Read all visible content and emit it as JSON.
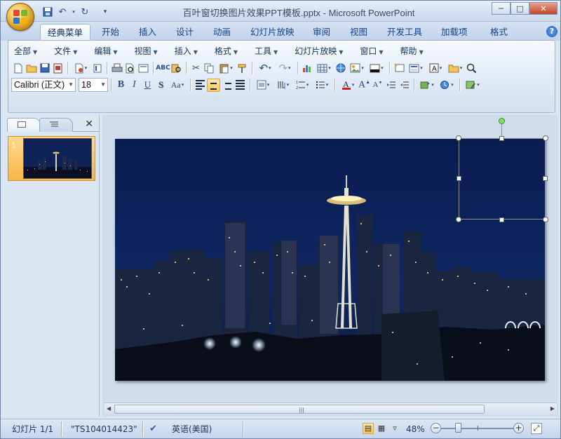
{
  "window": {
    "title": "百叶窗切换图片效果PPT模板.pptx - Microsoft PowerPoint",
    "controls": {
      "minimize": "─",
      "maximize": "□",
      "close": "✕"
    }
  },
  "quick_access": [
    "save-icon",
    "undo-icon",
    "redo-icon",
    "customize-icon"
  ],
  "tabs": [
    {
      "label": "经典菜单",
      "active": true
    },
    {
      "label": "开始"
    },
    {
      "label": "插入"
    },
    {
      "label": "设计"
    },
    {
      "label": "动画"
    },
    {
      "label": "幻灯片放映"
    },
    {
      "label": "审阅"
    },
    {
      "label": "视图"
    },
    {
      "label": "开发工具"
    },
    {
      "label": "加载项"
    },
    {
      "label": "格式"
    }
  ],
  "menus": [
    "全部",
    "文件",
    "编辑",
    "视图",
    "插入",
    "格式",
    "工具",
    "幻灯片放映",
    "窗口",
    "帮助"
  ],
  "font": {
    "family": "Calibri (正文)",
    "size": "18"
  },
  "format_buttons": {
    "bold": "B",
    "italic": "I",
    "underline": "U",
    "shadow": "S",
    "change_case": "Aa"
  },
  "slides_panel": {
    "thumbnail_number": "1"
  },
  "status": {
    "slide": "幻灯片 1/1",
    "theme": "\"TS104014423\"",
    "language": "英语(美国)",
    "zoom": "48%"
  },
  "zoom_level": 48,
  "colors": {
    "accent_orange": "#f7b64c",
    "ribbon_blue": "#dfe9f6",
    "font_color_red": "#d22020",
    "night_sky": "#0c2257"
  }
}
